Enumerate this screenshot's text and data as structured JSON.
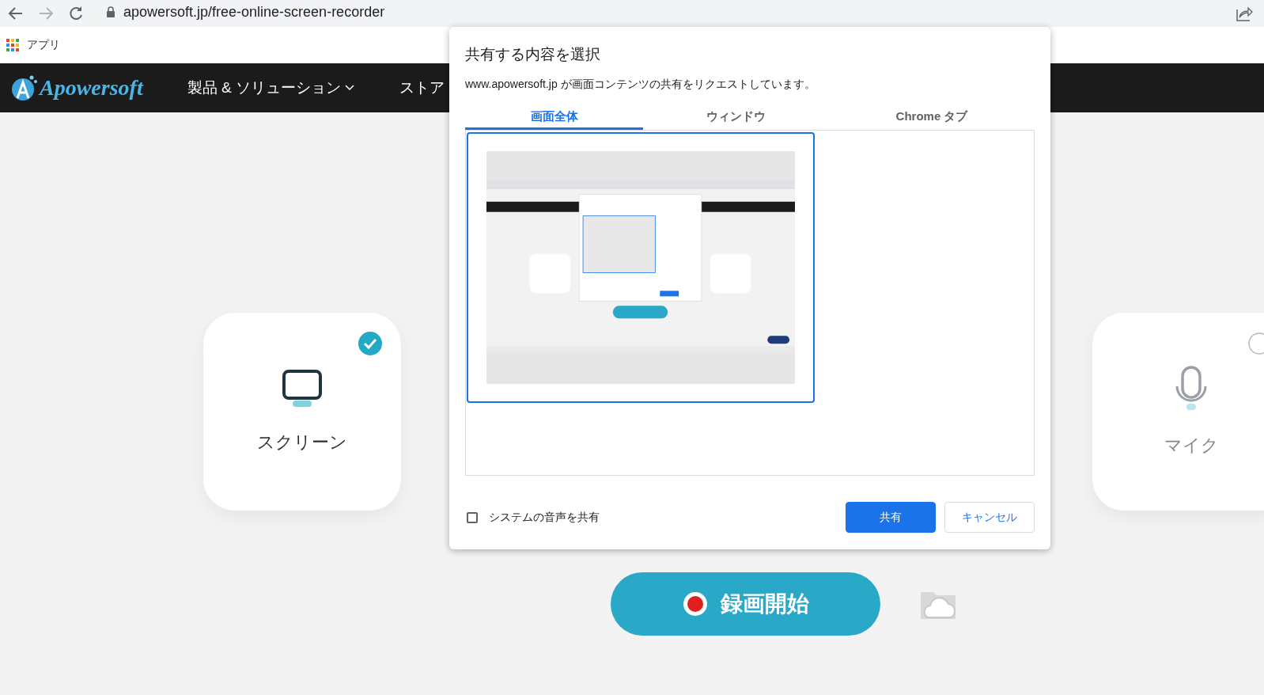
{
  "browser": {
    "url": "apowersoft.jp/free-online-screen-recorder",
    "bookmarks": [
      {
        "label": "アプリ"
      }
    ]
  },
  "site": {
    "logo": "Apowersoft",
    "nav": [
      {
        "label": "製品 & ソリューション",
        "dropdown": true
      },
      {
        "label": "ストア",
        "dropdown": false
      }
    ]
  },
  "sources": [
    {
      "label": "スクリーン",
      "kind": "screen",
      "selected": true
    },
    {
      "label": "マイク",
      "kind": "mic",
      "selected": false
    }
  ],
  "record_button": {
    "label": "録画開始"
  },
  "dialog": {
    "title": "共有する内容を選択",
    "message": "www.apowersoft.jp が画面コンテンツの共有をリクエストしています。",
    "tabs": [
      {
        "label": "画面全体",
        "selected": true
      },
      {
        "label": "ウィンドウ",
        "selected": false
      },
      {
        "label": "Chrome タブ",
        "selected": false
      }
    ],
    "previews": [
      {
        "kind": "picture",
        "selected": true
      }
    ],
    "checkbox": {
      "label": "システムの音声を共有",
      "checked": false
    },
    "buttons": [
      {
        "label": "共有",
        "kind": "primary"
      },
      {
        "label": "キャンセル",
        "kind": "secondary"
      }
    ]
  }
}
